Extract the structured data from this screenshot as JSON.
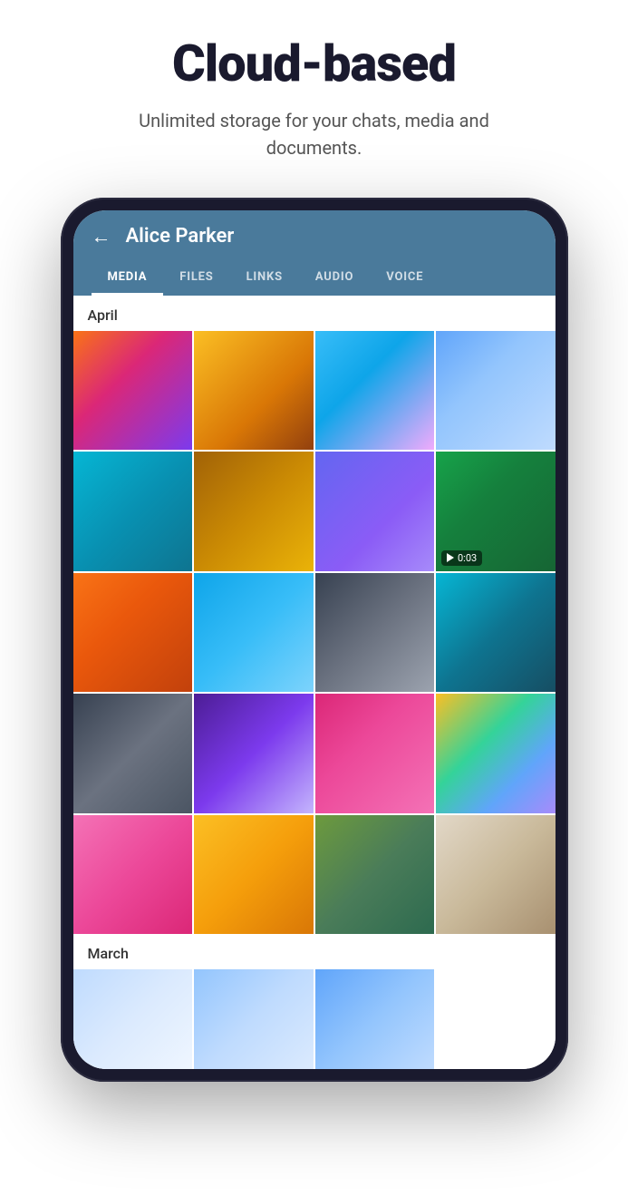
{
  "hero": {
    "title": "Cloud-based",
    "subtitle": "Unlimited storage for your chats, media and documents."
  },
  "phone": {
    "header": {
      "back_label": "←",
      "chat_name": "Alice Parker"
    },
    "tabs": [
      {
        "id": "media",
        "label": "MEDIA",
        "active": true
      },
      {
        "id": "files",
        "label": "FILES",
        "active": false
      },
      {
        "id": "links",
        "label": "LINKS",
        "active": false
      },
      {
        "id": "audio",
        "label": "AUDIO",
        "active": false
      },
      {
        "id": "voice",
        "label": "VOICE",
        "active": false
      }
    ],
    "sections": [
      {
        "month": "April",
        "rows": [
          [
            "img-sunset",
            "img-drinks",
            "img-beach",
            "img-lifeguard"
          ],
          [
            "img-surf",
            "img-wood",
            "img-friends",
            "img-lake-autumn"
          ],
          [
            "img-autumn-tree",
            "img-lake-calm",
            "img-road",
            "img-turtle"
          ],
          [
            "img-car-classic",
            "img-concert",
            "img-car-pink",
            "img-colorful"
          ],
          [
            "img-woman",
            "img-yellow-car",
            "img-lion",
            "img-cat"
          ]
        ],
        "video_cell": {
          "row": 1,
          "col": 3,
          "duration": "0:03"
        }
      },
      {
        "month": "March",
        "partial_row": [
          "img-snowy1",
          "img-snowy2",
          "img-snowy3"
        ]
      }
    ]
  },
  "icons": {
    "back_arrow": "←",
    "play": "▶"
  }
}
